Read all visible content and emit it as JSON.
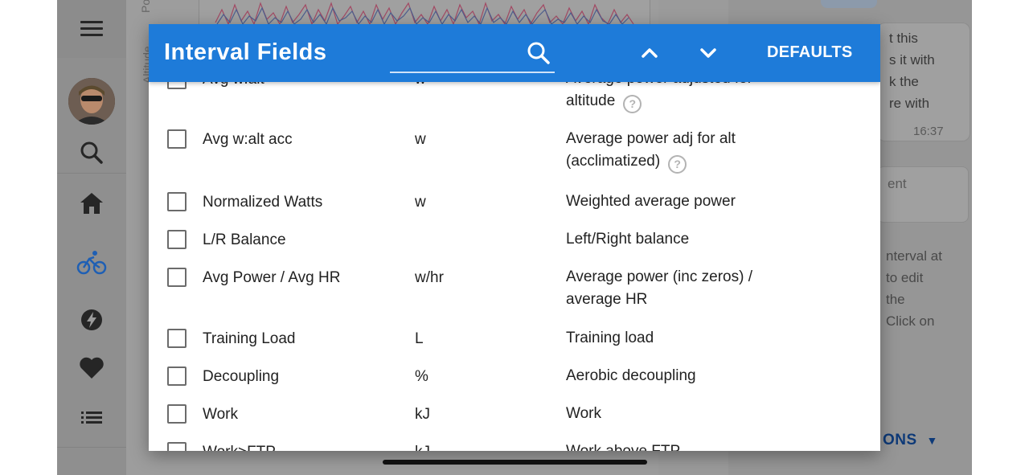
{
  "background": {
    "chart_axis_top_label": "Po",
    "chart_axis_label": "Altitude",
    "chat_message": [
      "t this",
      "s it with",
      "k the",
      "re with"
    ],
    "chat_time": "16:37",
    "note_text": "ent",
    "hint_lines": [
      "nterval at",
      "to edit",
      "the",
      "Click on"
    ],
    "options_label": "ONS"
  },
  "dialog": {
    "title": "Interval Fields",
    "search_placeholder": "",
    "defaults_label": "DEFAULTS",
    "rows": [
      {
        "name": "Avg w:alt",
        "unit": "w",
        "desc": "Average power adjusted for",
        "desc2": "altitude",
        "help": "?"
      },
      {
        "name": "Avg w:alt acc",
        "unit": "w",
        "desc": "Average power adj for alt",
        "desc2": "(acclimatized)",
        "help": "?"
      },
      {
        "name": "Normalized Watts",
        "unit": "w",
        "desc": "Weighted average power"
      },
      {
        "name": "L/R Balance",
        "unit": "",
        "desc": "Left/Right balance"
      },
      {
        "name": "Avg Power / Avg HR",
        "unit": "w/hr",
        "desc": "Average power (inc zeros) /",
        "desc2": "average HR"
      },
      {
        "name": "Training Load",
        "unit": "L",
        "desc": "Training load"
      },
      {
        "name": "Decoupling",
        "unit": "%",
        "desc": "Aerobic decoupling"
      },
      {
        "name": "Work",
        "unit": "kJ",
        "desc": "Work"
      },
      {
        "name": "Work>FTP",
        "unit": "kJ",
        "desc": "Work above FTP"
      }
    ]
  },
  "colors": {
    "header": "#1e7bd9",
    "active_nav": "#1e5fb4"
  },
  "icons": [
    "menu-icon",
    "search-icon",
    "home-icon",
    "bike-icon",
    "bolt-icon",
    "heart-icon",
    "list-icon",
    "chevron-up-icon",
    "chevron-down-icon"
  ]
}
